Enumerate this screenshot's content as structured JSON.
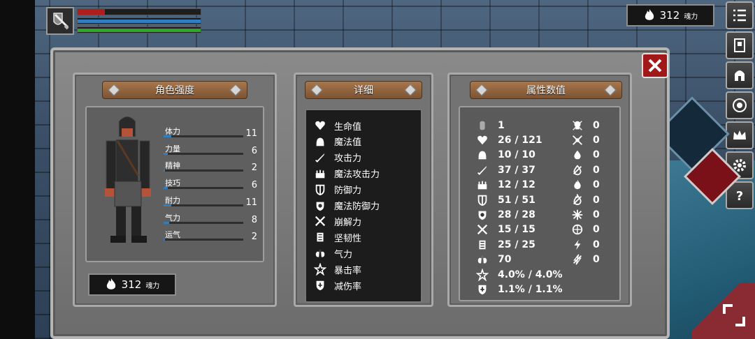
{
  "hud": {
    "hp": 0.22,
    "mp": 1.0,
    "stamina": 1.0,
    "weapon_icon": "sword-shield-icon"
  },
  "soul_top": {
    "value": "312",
    "label": "魂力"
  },
  "menu": [
    "list-icon",
    "inventory-icon",
    "helmet-icon",
    "rune-icon",
    "crown-icon",
    "gear-icon",
    "help-icon"
  ],
  "panels": {
    "character": {
      "title": "角色强度"
    },
    "detail": {
      "title": "详细"
    },
    "attributes": {
      "title": "属性数值"
    }
  },
  "stats": [
    {
      "name": "体力",
      "value": "11",
      "fill": 0.1
    },
    {
      "name": "力量",
      "value": "6",
      "fill": 0.05
    },
    {
      "name": "精神",
      "value": "2",
      "fill": 0.02
    },
    {
      "name": "技巧",
      "value": "6",
      "fill": 0.05
    },
    {
      "name": "耐力",
      "value": "11",
      "fill": 0.1
    },
    {
      "name": "气力",
      "value": "8",
      "fill": 0.07
    },
    {
      "name": "运气",
      "value": "2",
      "fill": 0.02
    }
  ],
  "soul_box": {
    "value": "312",
    "label": "魂力"
  },
  "details": [
    {
      "label": "生命值",
      "icon": "heart-icon"
    },
    {
      "label": "魔法值",
      "icon": "mana-icon"
    },
    {
      "label": "攻击力",
      "icon": "sword-icon"
    },
    {
      "label": "魔法攻击力",
      "icon": "magic-attack-icon"
    },
    {
      "label": "防御力",
      "icon": "shield-icon"
    },
    {
      "label": "魔法防御力",
      "icon": "magic-shield-icon"
    },
    {
      "label": "崩解力",
      "icon": "break-icon"
    },
    {
      "label": "坚韧性",
      "icon": "armor-icon"
    },
    {
      "label": "气力",
      "icon": "lungs-icon"
    },
    {
      "label": "暴击率",
      "icon": "crit-star-icon"
    },
    {
      "label": "减伤率",
      "icon": "reduction-shield-icon"
    }
  ],
  "attr_left": [
    {
      "icon": "level-icon",
      "value": "1"
    },
    {
      "icon": "heart-icon",
      "value": "26 / 121"
    },
    {
      "icon": "mana-icon",
      "value": "10 / 10"
    },
    {
      "icon": "sword-icon",
      "value": "37 / 37"
    },
    {
      "icon": "magic-attack-icon",
      "value": "12 / 12"
    },
    {
      "icon": "shield-icon",
      "value": "51 / 51"
    },
    {
      "icon": "magic-shield-icon",
      "value": "28 / 28"
    },
    {
      "icon": "break-icon",
      "value": "15 / 15"
    },
    {
      "icon": "armor-icon",
      "value": "25 / 25"
    },
    {
      "icon": "lungs-icon",
      "value": "70"
    },
    {
      "icon": "crit-star-icon",
      "value": "4.0% / 4.0%"
    },
    {
      "icon": "reduction-shield-icon",
      "value": "1.1% / 1.1%"
    }
  ],
  "attr_right": [
    {
      "icon": "skull-icon",
      "value": "0"
    },
    {
      "icon": "poison-icon",
      "value": "0"
    },
    {
      "icon": "drop-icon",
      "value": "0"
    },
    {
      "icon": "bleed-icon",
      "value": "0"
    },
    {
      "icon": "fire-icon",
      "value": "0"
    },
    {
      "icon": "fire-resist-icon",
      "value": "0"
    },
    {
      "icon": "frost-icon",
      "value": "0"
    },
    {
      "icon": "frost-resist-icon",
      "value": "0"
    },
    {
      "icon": "lightning-icon",
      "value": "0"
    },
    {
      "icon": "lightning-resist-icon",
      "value": "0"
    }
  ]
}
